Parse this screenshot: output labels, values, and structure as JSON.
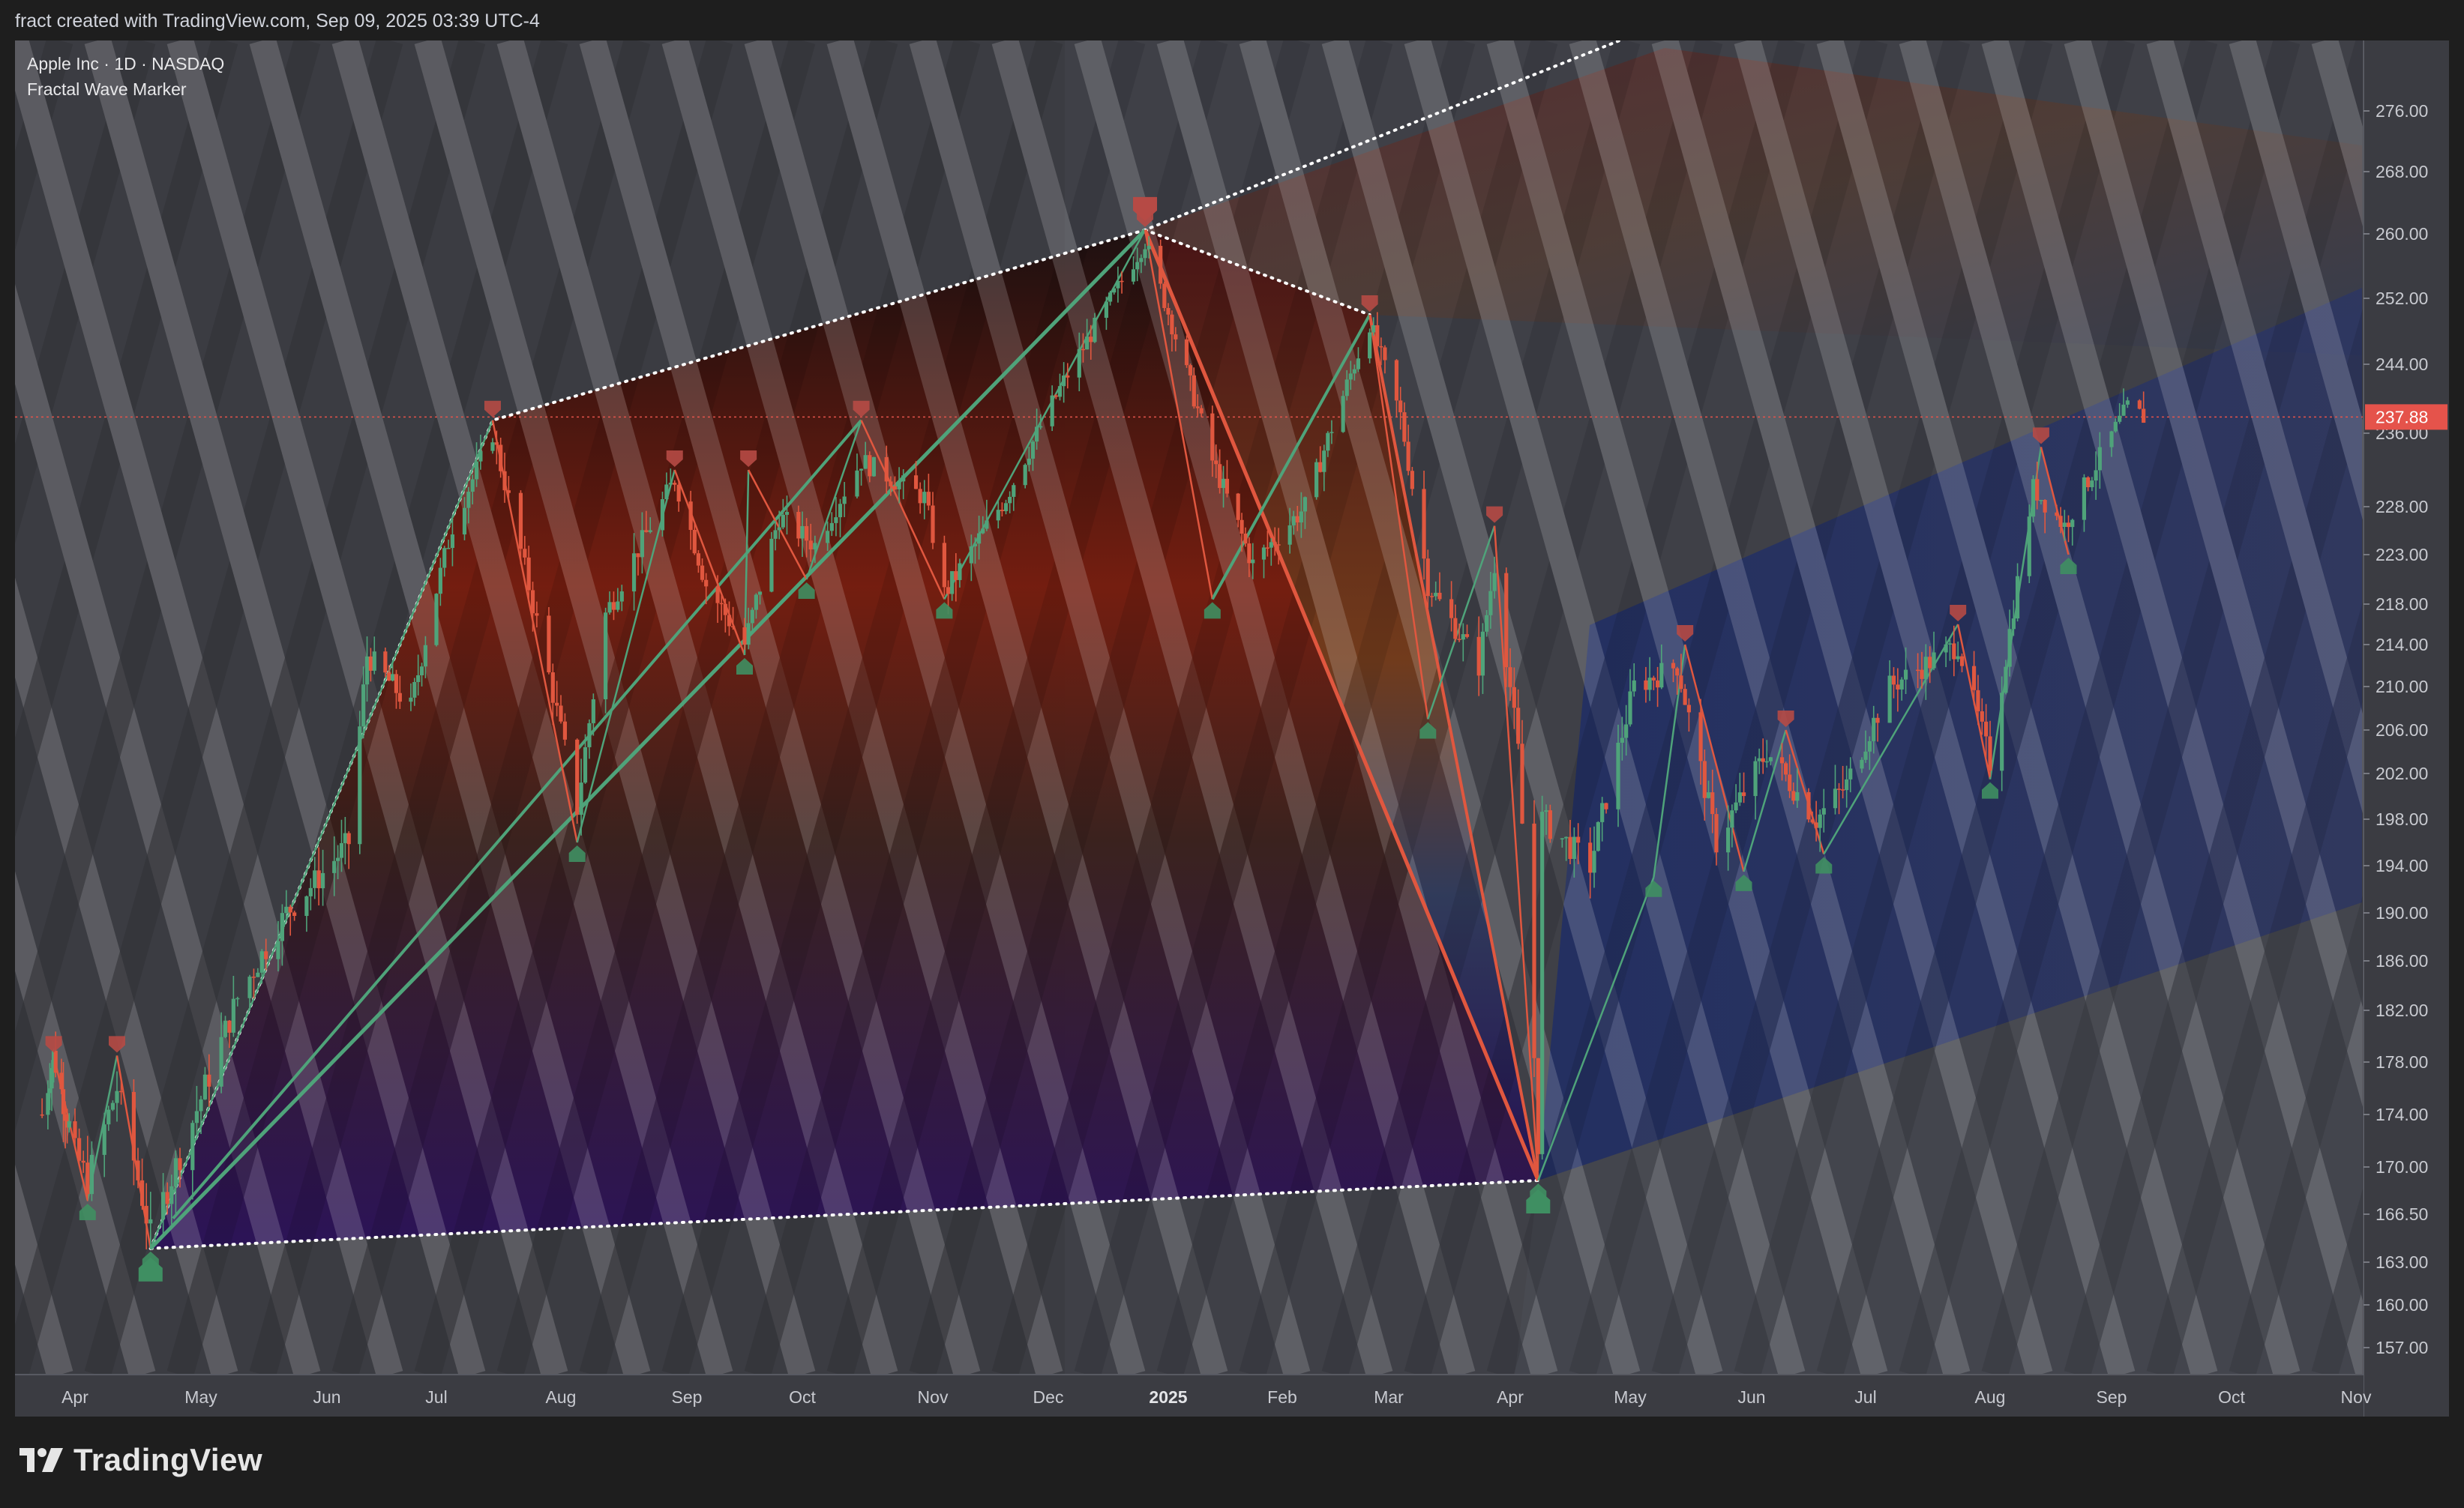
{
  "header": {
    "credit": "fract created with TradingView.com, Sep 09, 2025 03:39 UTC-4"
  },
  "legend": {
    "symbol": "Apple Inc · 1D · NASDAQ",
    "indicator": "Fractal Wave Marker"
  },
  "brand": {
    "name": "TradingView"
  },
  "price_label": {
    "value": "237.88",
    "color": "#e5534b"
  },
  "colors": {
    "up": "#4fa37a",
    "down": "#e0573f",
    "bg": "#3b3c42",
    "page": "#1e1e1e",
    "peak": "#b64a45",
    "trough": "#3f8f62",
    "price_line": "#e5534b"
  },
  "chart_data": {
    "type": "candlestick",
    "symbol": "Apple Inc",
    "interval": "1D",
    "exchange": "NASDAQ",
    "indicator": "Fractal Wave Marker",
    "last_price": 237.88,
    "y_ticks": [
      157.0,
      160.0,
      163.0,
      166.5,
      170.0,
      174.0,
      178.0,
      182.0,
      186.0,
      190.0,
      194.0,
      198.0,
      202.0,
      206.0,
      210.0,
      214.0,
      218.0,
      223.0,
      228.0,
      236.0,
      244.0,
      252.0,
      260.0,
      268.0,
      276.0
    ],
    "y_tick_labels": [
      "157.00",
      "160.00",
      "163.00",
      "166.50",
      "170.00",
      "174.00",
      "178.00",
      "182.00",
      "186.00",
      "190.00",
      "194.00",
      "198.00",
      "202.00",
      "206.00",
      "210.00",
      "214.00",
      "218.00",
      "223.00",
      "228.00",
      "236.00",
      "244.00",
      "252.00",
      "260.00",
      "268.00",
      "276.00"
    ],
    "x_ticks": [
      {
        "label": "Apr",
        "date": "2024-04-01"
      },
      {
        "label": "May",
        "date": "2024-05-01"
      },
      {
        "label": "Jun",
        "date": "2024-06-01"
      },
      {
        "label": "Jul",
        "date": "2024-07-01"
      },
      {
        "label": "Aug",
        "date": "2024-08-01"
      },
      {
        "label": "Sep",
        "date": "2024-09-01"
      },
      {
        "label": "Oct",
        "date": "2024-10-01"
      },
      {
        "label": "Nov",
        "date": "2024-11-01"
      },
      {
        "label": "Dec",
        "date": "2024-12-01"
      },
      {
        "label": "2025",
        "date": "2025-01-01",
        "bold": true
      },
      {
        "label": "Feb",
        "date": "2025-02-01"
      },
      {
        "label": "Mar",
        "date": "2025-03-01"
      },
      {
        "label": "Apr",
        "date": "2025-04-01"
      },
      {
        "label": "May",
        "date": "2025-05-01"
      },
      {
        "label": "Jun",
        "date": "2025-06-01"
      },
      {
        "label": "Jul",
        "date": "2025-07-01"
      },
      {
        "label": "Aug",
        "date": "2025-08-01"
      },
      {
        "label": "Sep",
        "date": "2025-09-01"
      },
      {
        "label": "Oct",
        "date": "2025-10-01"
      },
      {
        "label": "Nov",
        "date": "2025-11-01"
      }
    ],
    "price_path": [
      {
        "date": "2024-03-15",
        "close": 174.0
      },
      {
        "date": "2024-03-21",
        "close": 178.5
      },
      {
        "date": "2024-04-04",
        "close": 169.0
      },
      {
        "date": "2024-04-11",
        "close": 176.0
      },
      {
        "date": "2024-04-19",
        "close": 165.0
      },
      {
        "date": "2024-04-29",
        "close": 173.5
      },
      {
        "date": "2024-05-10",
        "close": 183.0
      },
      {
        "date": "2024-05-22",
        "close": 190.0
      },
      {
        "date": "2024-06-07",
        "close": 196.0
      },
      {
        "date": "2024-06-12",
        "close": 213.0
      },
      {
        "date": "2024-06-24",
        "close": 208.0
      },
      {
        "date": "2024-07-05",
        "close": 226.0
      },
      {
        "date": "2024-07-15",
        "close": 236.0
      },
      {
        "date": "2024-07-25",
        "close": 218.0
      },
      {
        "date": "2024-08-05",
        "close": 199.0
      },
      {
        "date": "2024-08-12",
        "close": 217.0
      },
      {
        "date": "2024-08-23",
        "close": 226.0
      },
      {
        "date": "2024-08-29",
        "close": 231.0
      },
      {
        "date": "2024-09-06",
        "close": 220.0
      },
      {
        "date": "2024-09-16",
        "close": 214.0
      },
      {
        "date": "2024-09-25",
        "close": 227.0
      },
      {
        "date": "2024-10-04",
        "close": 224.0
      },
      {
        "date": "2024-10-15",
        "close": 233.0
      },
      {
        "date": "2024-10-30",
        "close": 229.0
      },
      {
        "date": "2024-11-04",
        "close": 219.0
      },
      {
        "date": "2024-11-20",
        "close": 229.0
      },
      {
        "date": "2024-12-05",
        "close": 242.0
      },
      {
        "date": "2024-12-26",
        "close": 259.0
      },
      {
        "date": "2025-01-06",
        "close": 243.0
      },
      {
        "date": "2025-01-13",
        "close": 233.0
      },
      {
        "date": "2025-01-24",
        "close": 222.0
      },
      {
        "date": "2025-02-07",
        "close": 228.0
      },
      {
        "date": "2025-02-24",
        "close": 249.0
      },
      {
        "date": "2025-03-04",
        "close": 238.0
      },
      {
        "date": "2025-03-11",
        "close": 220.0
      },
      {
        "date": "2025-03-24",
        "close": 212.0
      },
      {
        "date": "2025-03-28",
        "close": 222.0
      },
      {
        "date": "2025-04-03",
        "close": 204.0
      },
      {
        "date": "2025-04-08",
        "close": 172.0
      },
      {
        "date": "2025-04-09",
        "close": 198.0
      },
      {
        "date": "2025-04-21",
        "close": 194.0
      },
      {
        "date": "2025-05-02",
        "close": 210.0
      },
      {
        "date": "2025-05-13",
        "close": 212.0
      },
      {
        "date": "2025-05-23",
        "close": 196.0
      },
      {
        "date": "2025-06-05",
        "close": 204.0
      },
      {
        "date": "2025-06-18",
        "close": 198.0
      },
      {
        "date": "2025-06-26",
        "close": 201.0
      },
      {
        "date": "2025-07-07",
        "close": 210.0
      },
      {
        "date": "2025-07-24",
        "close": 214.0
      },
      {
        "date": "2025-08-01",
        "close": 203.0
      },
      {
        "date": "2025-08-12",
        "close": 230.0
      },
      {
        "date": "2025-08-20",
        "close": 226.0
      },
      {
        "date": "2025-09-05",
        "close": 239.0
      },
      {
        "date": "2025-09-09",
        "close": 237.88
      }
    ],
    "fractal_peaks": [
      {
        "date": "2024-03-21",
        "price": 178.5
      },
      {
        "date": "2024-04-11",
        "price": 178.5
      },
      {
        "date": "2024-07-15",
        "price": 237.5
      },
      {
        "date": "2024-08-29",
        "price": 232.0
      },
      {
        "date": "2024-09-17",
        "price": 232.0
      },
      {
        "date": "2024-10-15",
        "price": 237.5
      },
      {
        "date": "2024-12-26",
        "price": 260.5
      },
      {
        "date": "2025-02-24",
        "price": 250.0
      },
      {
        "date": "2025-03-28",
        "price": 226.0
      },
      {
        "date": "2025-05-15",
        "price": 214.0
      },
      {
        "date": "2025-06-10",
        "price": 206.0
      },
      {
        "date": "2025-07-24",
        "price": 216.0
      },
      {
        "date": "2025-08-14",
        "price": 234.5
      }
    ],
    "fractal_troughs": [
      {
        "date": "2024-04-04",
        "price": 167.5
      },
      {
        "date": "2024-04-19",
        "price": 164.0
      },
      {
        "date": "2024-08-05",
        "price": 196.0
      },
      {
        "date": "2024-09-16",
        "price": 213.0
      },
      {
        "date": "2024-10-02",
        "price": 220.5
      },
      {
        "date": "2024-11-04",
        "price": 218.5
      },
      {
        "date": "2025-01-13",
        "price": 218.5
      },
      {
        "date": "2025-03-11",
        "price": 207.0
      },
      {
        "date": "2025-04-08",
        "price": 169.0
      },
      {
        "date": "2025-05-07",
        "price": 193.0
      },
      {
        "date": "2025-05-30",
        "price": 193.5
      },
      {
        "date": "2025-06-20",
        "price": 195.0
      },
      {
        "date": "2025-08-01",
        "price": 201.5
      },
      {
        "date": "2025-08-21",
        "price": 223.0
      }
    ],
    "major_swings": [
      {
        "date": "2024-04-19",
        "price": 164.0
      },
      {
        "date": "2024-12-26",
        "price": 260.5
      },
      {
        "date": "2025-04-08",
        "price": 169.0
      }
    ]
  }
}
